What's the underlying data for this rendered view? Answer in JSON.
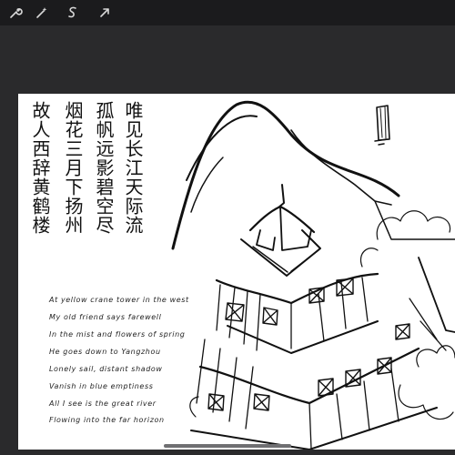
{
  "toolbar": {
    "tools": [
      {
        "name": "wrench-icon"
      },
      {
        "name": "magic-wand-icon"
      },
      {
        "name": "selection-icon"
      },
      {
        "name": "transform-arrow-icon"
      }
    ]
  },
  "poem": {
    "columns": [
      "唯见长江天际流",
      "孤帆远影碧空尽",
      "烟花三月下扬州",
      "故人西辞黄鹤楼"
    ],
    "translation": [
      "At yellow crane tower in the west",
      "My old friend says farewell",
      "In the mist and flowers of spring",
      "He goes down to Yangzhou",
      "Lonely sail, distant shadow",
      "Vanish in blue emptiness",
      "All I see is the great river",
      "Flowing into the far horizon"
    ]
  },
  "colors": {
    "app_background": "#2a2a2c",
    "toolbar": "#1b1b1d",
    "paper": "#ffffff",
    "ink": "#111111"
  }
}
